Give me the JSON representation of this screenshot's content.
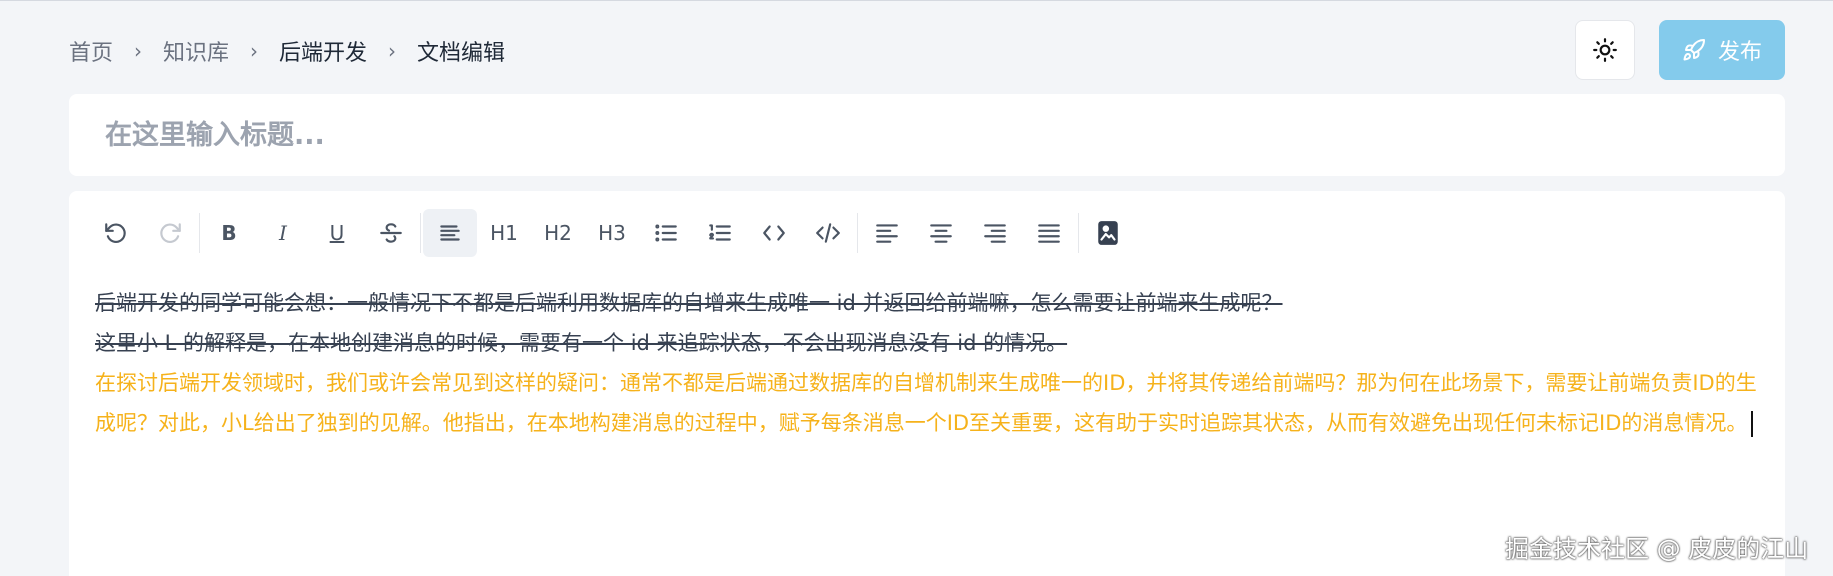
{
  "breadcrumb": {
    "items": [
      "首页",
      "知识库",
      "后端开发",
      "文档编辑"
    ],
    "separator": "›"
  },
  "header": {
    "theme_icon": "sun-icon",
    "publish_icon": "rocket-icon",
    "publish_label": "发布",
    "publish_color": "#84cbec"
  },
  "title": {
    "placeholder": "在这里输入标题...",
    "value": ""
  },
  "toolbar": {
    "undo_icon": "undo-icon",
    "redo_icon": "redo-icon",
    "bold": "B",
    "italic": "I",
    "underline": "U",
    "strike_icon": "strikethrough-icon",
    "paragraph_icon": "paragraph-icon",
    "h1": "H1",
    "h2": "H2",
    "h3": "H3",
    "bullet_icon": "bullet-list-icon",
    "ordered_icon": "ordered-list-icon",
    "code_icon": "inline-code-icon",
    "codeblock_icon": "code-block-icon",
    "align_left_icon": "align-left-icon",
    "align_center_icon": "align-center-icon",
    "align_right_icon": "align-right-icon",
    "align_justify_icon": "align-justify-icon",
    "image_icon": "image-icon"
  },
  "content": {
    "struck_line_1": "后端开发的同学可能会想：一般情况下不都是后端利用数据库的自增来生成唯一 id 并返回给前端嘛，怎么需要让前端来生成呢？",
    "struck_line_2": "这里小 L 的解释是，在本地创建消息的时候，需要有一个 id 来追踪状态，不会出现消息没有 id 的情况。",
    "suggested_text": "在探讨后端开发领域时，我们或许会常见到这样的疑问：通常不都是后端通过数据库的自增机制来生成唯一的ID，并将其传递给前端吗？那为何在此场景下，需要让前端负责ID的生成呢？对此，小L给出了独到的见解。他指出，在本地构建消息的过程中，赋予每条消息一个ID至关重要，这有助于实时追踪其状态，从而有效避免出现任何未标记ID的消息情况。",
    "struck_color": "#374151",
    "suggested_color": "#f6b21b"
  },
  "watermark": "掘金技术社区 @ 皮皮的江山"
}
